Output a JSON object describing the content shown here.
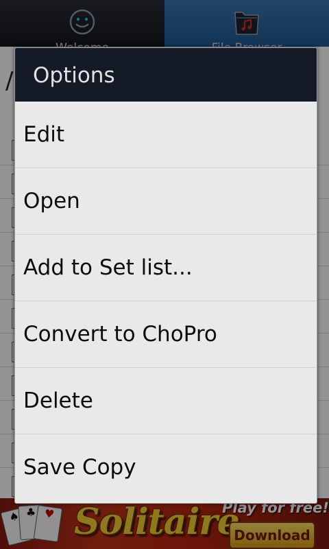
{
  "tabs": [
    {
      "label": "Welcome",
      "icon": "smiley-icon"
    },
    {
      "label": "File Browser",
      "icon": "music-folder-icon"
    }
  ],
  "browser": {
    "path": "/",
    "files": [
      {
        "name": ""
      },
      {
        "name": ""
      },
      {
        "name": ""
      },
      {
        "name": ""
      },
      {
        "name": ""
      },
      {
        "name": ""
      },
      {
        "name": ""
      },
      {
        "name": ""
      },
      {
        "name": ""
      },
      {
        "name": ""
      },
      {
        "name": ""
      }
    ]
  },
  "dialog": {
    "title": "Options",
    "items": [
      {
        "label": "Edit"
      },
      {
        "label": "Open"
      },
      {
        "label": "Add to Set list..."
      },
      {
        "label": "Convert to ChoPro"
      },
      {
        "label": "Delete"
      },
      {
        "label": "Save Copy"
      }
    ]
  },
  "ad": {
    "title": "Solitaire",
    "tagline": "Play for free!",
    "button": "Download"
  },
  "colors": {
    "dialog_header": "#141a26",
    "dialog_body": "#e9e9e9",
    "tab_active": "#1f5a96",
    "ad_title": "#f7d230"
  }
}
